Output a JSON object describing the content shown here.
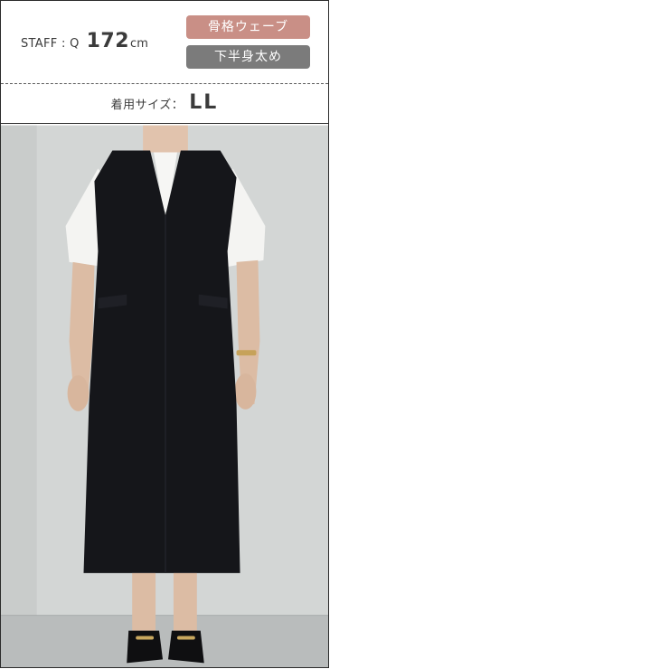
{
  "staff": {
    "label": "STAFF : Q",
    "height_value": "172",
    "height_unit": "cm"
  },
  "badges": [
    {
      "text": "骨格ウェーブ",
      "color": "#c98f86"
    },
    {
      "text": "下半身太め",
      "color": "#7b7b7b"
    }
  ],
  "size": {
    "label": "着用サイズ：",
    "value": "LL"
  },
  "colors": {
    "border": "#2b2b2b",
    "text": "#3b3b3b",
    "wall": "#d3d6d5",
    "floor": "#b9bcbc",
    "dress": "#15161a"
  }
}
